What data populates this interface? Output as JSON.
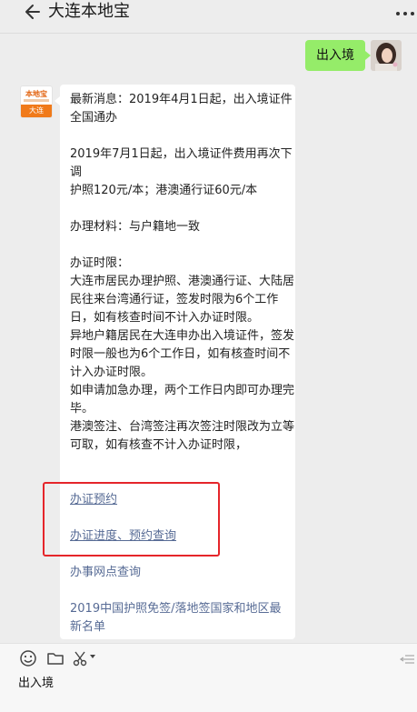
{
  "header": {
    "title": "大连本地宝"
  },
  "user_message": {
    "text": "出入境"
  },
  "bot": {
    "avatar_logo": "本地宝",
    "avatar_city": "大连"
  },
  "bot_message": {
    "paragraphs": [
      "最新消息：2019年4月1日起，出入境证件全国通办",
      "2019年7月1日起，出入境证件费用再次下调\n护照120元/本；港澳通行证60元/本",
      "办理材料：与户籍地一致",
      "办证时限：\n大连市居民办理护照、港澳通行证、大陆居民往来台湾通行证，签发时限为6个工作日，如有核查时间不计入办证时限。\n异地户籍居民在大连申办出入境证件，签发时限一般也为6个工作日，如有核查时间不计入办证时限。\n如申请加急办理，两个工作日内即可办理完毕。\n港澳签注、台湾签注再次签注时限改为立等可取，如有核查不计入办证时限，"
    ],
    "links": [
      "办证预约",
      "办证进度、预约查询",
      "办事网点查询",
      "2019中国护照免签/落地签国家和地区最新名单"
    ]
  },
  "input": {
    "value": "出入境"
  },
  "icons": {
    "back": "back-arrow-icon",
    "more": "more-icon",
    "emoji": "emoji-icon",
    "folder": "folder-icon",
    "scissors": "scissors-icon",
    "collapse": "collapse-icon"
  },
  "colors": {
    "user_bubble": "#95ec69",
    "link": "#576b95",
    "highlight_box": "#e5252a",
    "brand_orange": "#f07a1a"
  }
}
